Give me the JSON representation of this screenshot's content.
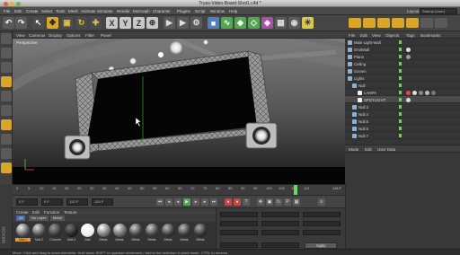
{
  "window": {
    "title": "Truss-Video-Board-Shot1.c4d *"
  },
  "menubar": {
    "items": [
      "File",
      "Edit",
      "Create",
      "Select",
      "Tools",
      "Mesh",
      "Animate",
      "Simulate",
      "Render",
      "MoGraph",
      "Character",
      "Plugins",
      "Script",
      "Window",
      "Help"
    ],
    "layout_label": "Layout:",
    "layout_value": "Startup (User)"
  },
  "viewport": {
    "menu": [
      "View",
      "Cameras",
      "Display",
      "Options",
      "Filter",
      "Panel"
    ],
    "label": "Perspective"
  },
  "object_manager": {
    "menu": [
      "File",
      "Edit",
      "View",
      "Objects",
      "Tags",
      "Bookmarks"
    ],
    "objects": [
      {
        "name": "Main-Light-Wall",
        "indent": 0,
        "color": "#8ab3d8"
      },
      {
        "name": "OmitWall",
        "indent": 0,
        "color": "#8ab3d8"
      },
      {
        "name": "Plane",
        "indent": 0,
        "color": "#8ab3d8"
      },
      {
        "name": "Ceiling",
        "indent": 0,
        "color": "#8ab3d8"
      },
      {
        "name": "Screen",
        "indent": 0,
        "color": "#8ab3d8"
      },
      {
        "name": "Lights",
        "indent": 0,
        "color": "#8ab3d8"
      },
      {
        "name": "Null",
        "indent": 1,
        "color": "#8ab3d8"
      },
      {
        "name": "LAMPA",
        "indent": 2,
        "color": "#e8e8e8"
      },
      {
        "name": "SPOTLIGHT",
        "indent": 2,
        "color": "#e8e8e8"
      },
      {
        "name": "Null.3",
        "indent": 1,
        "color": "#8ab3d8"
      },
      {
        "name": "Null.4",
        "indent": 1,
        "color": "#8ab3d8"
      },
      {
        "name": "Null.5",
        "indent": 1,
        "color": "#8ab3d8"
      },
      {
        "name": "Null.6",
        "indent": 1,
        "color": "#8ab3d8"
      },
      {
        "name": "Null.7",
        "indent": 1,
        "color": "#8ab3d8"
      }
    ]
  },
  "attribute_manager": {
    "menu": [
      "Mode",
      "Edit",
      "User Data"
    ]
  },
  "timeline": {
    "ticks": [
      "0",
      "5",
      "10",
      "15",
      "20",
      "25",
      "30",
      "35",
      "40",
      "45",
      "50",
      "55",
      "60",
      "65",
      "70",
      "75",
      "80",
      "85",
      "90",
      "95",
      "100",
      "105",
      "110",
      "115"
    ],
    "current_frame_fraction": 0.92,
    "end_label": "118 F"
  },
  "transport": {
    "start_field": "0 F",
    "current_field": "0 F",
    "end_field": "120 F",
    "end_field2": "120 F"
  },
  "material_manager": {
    "menu": [
      "Create",
      "Edit",
      "Function",
      "Texture"
    ],
    "filters": [
      {
        "label": "All",
        "active": true
      },
      {
        "label": "No Layer",
        "active": false
      },
      {
        "label": "Metal",
        "active": false
      }
    ],
    "materials": [
      {
        "name": "Mat.1",
        "selected": true,
        "shade": "metal-dark"
      },
      {
        "name": "Mat.2",
        "selected": false,
        "shade": "metal-dark"
      },
      {
        "name": "Concret",
        "selected": false,
        "shade": "dark"
      },
      {
        "name": "Mat.3",
        "selected": false,
        "shade": "dark"
      },
      {
        "name": "Mat",
        "selected": false,
        "shade": "white"
      },
      {
        "name": "Metal-",
        "selected": false,
        "shade": "metal"
      },
      {
        "name": "Metal-",
        "selected": false,
        "shade": "metal"
      },
      {
        "name": "Metal-",
        "selected": false,
        "shade": "metal-dark"
      },
      {
        "name": "Metal-",
        "selected": false,
        "shade": "metal-dark"
      },
      {
        "name": "Metal-",
        "selected": false,
        "shade": "metal-dark"
      },
      {
        "name": "Metal-",
        "selected": false,
        "shade": "metal-dark"
      },
      {
        "name": "Metal-",
        "selected": false,
        "shade": "metal-dark"
      }
    ]
  },
  "coordinates": {
    "apply_label": "Apply"
  },
  "status": {
    "text": "Move: Click and drag to move elements. Hold down SHIFT to quantize movement / add to the selection in point mode. CTRL to remove."
  },
  "brand": {
    "text": "MAXON"
  },
  "colors": {
    "accent": "#e59b2c",
    "timeline_marker": "#6fd36f",
    "object_icon": "#8ab3d8"
  }
}
